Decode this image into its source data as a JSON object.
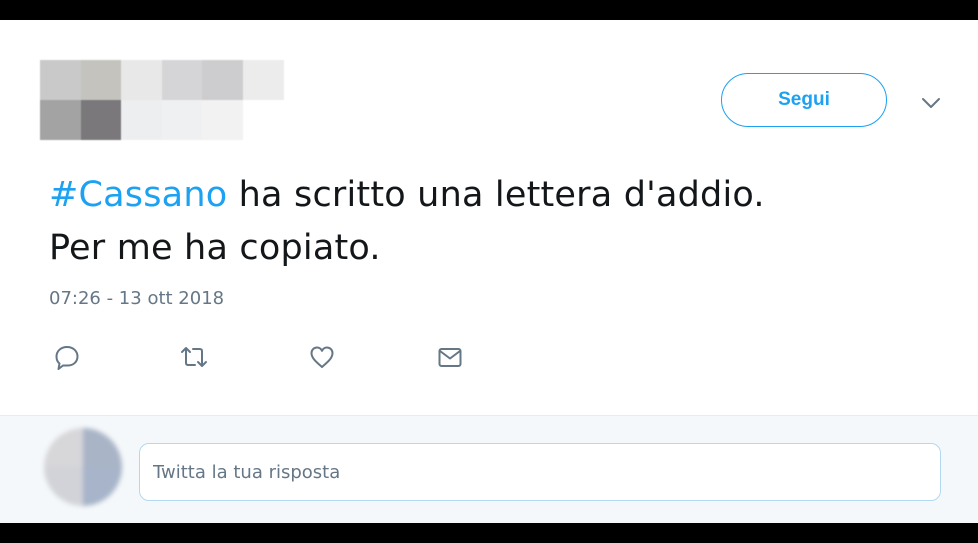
{
  "tweet": {
    "hashtag": "#Cassano",
    "text_line1_rest": " ha scritto una lettera d'addio.",
    "text_line2": "Per me ha copiato.",
    "timestamp": "07:26 - 13 ott 2018"
  },
  "header": {
    "follow_label": "Segui",
    "caret_icon": "chevron-down-icon",
    "avatar_state": "pixelated"
  },
  "actions": {
    "reply_icon": "reply-icon",
    "retweet_icon": "retweet-icon",
    "like_icon": "heart-icon",
    "dm_icon": "envelope-icon"
  },
  "reply": {
    "placeholder": "Twitta la tua risposta",
    "value": ""
  },
  "colors": {
    "accent": "#1da1f2",
    "text": "#14171a",
    "muted": "#657786",
    "reply_bar_bg": "#f5f8fa",
    "avatar_pixels_row1": [
      "#c9c9c9",
      "#c4c3bd",
      "#e8e8e8",
      "#d5d5d8",
      "#cdcdcf",
      "#ececec"
    ],
    "avatar_pixels_row2": [
      "#a3a3a3",
      "#7b787b",
      "#edeef0",
      "#eff0f2",
      "#f2f2f3",
      "#ffffff"
    ],
    "reply_avatar_pixels": [
      "#d7d7da",
      "#a9b4c7",
      "#d1d3d8",
      "#a7b4c9"
    ]
  }
}
